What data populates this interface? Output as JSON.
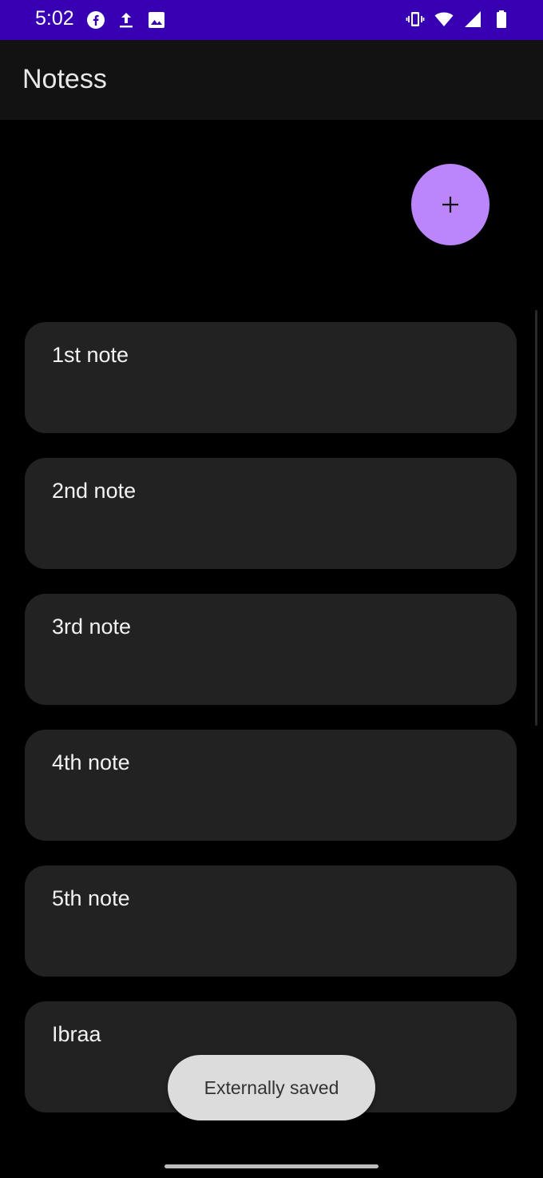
{
  "status_bar": {
    "time": "5:02",
    "left_icons": [
      "facebook-icon",
      "upload-icon",
      "image-icon"
    ],
    "right_icons": [
      "vibrate-icon",
      "wifi-icon",
      "signal-icon",
      "battery-icon"
    ],
    "color": "#3700b3"
  },
  "app_bar": {
    "title": "Notess"
  },
  "fab": {
    "icon": "plus-icon",
    "color": "#bb86fc"
  },
  "notes": [
    {
      "title": "1st note"
    },
    {
      "title": "2nd note"
    },
    {
      "title": "3rd note"
    },
    {
      "title": "4th note"
    },
    {
      "title": "5th note"
    },
    {
      "title": "Ibraa"
    }
  ],
  "toast": {
    "message": "Externally saved"
  }
}
